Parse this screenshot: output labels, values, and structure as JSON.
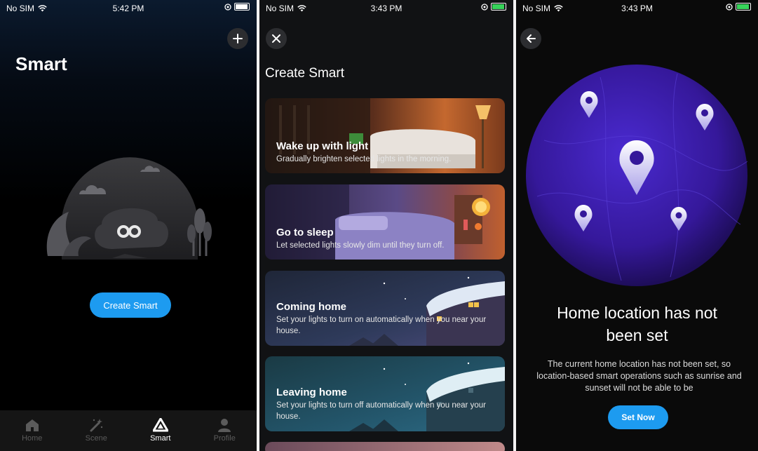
{
  "screens": [
    {
      "status": {
        "carrier": "No SIM",
        "time": "5:42 PM"
      },
      "title": "Smart",
      "add_icon": "plus-icon",
      "create_button": "Create Smart",
      "tabs": [
        {
          "label": "Home",
          "icon": "home-icon",
          "active": false
        },
        {
          "label": "Scene",
          "icon": "magic-wand-icon",
          "active": false
        },
        {
          "label": "Smart",
          "icon": "smart-triangle-icon",
          "active": true
        },
        {
          "label": "Profile",
          "icon": "profile-icon",
          "active": false
        }
      ]
    },
    {
      "status": {
        "carrier": "No SIM",
        "time": "3:43 PM"
      },
      "title": "Create Smart",
      "close_icon": "close-icon",
      "cards": [
        {
          "title": "Wake up with light",
          "description": "Gradually brighten selected lights in the morning."
        },
        {
          "title": "Go to sleep",
          "description": "Let selected lights slowly dim until they turn off."
        },
        {
          "title": "Coming home",
          "description": "Set your lights to turn on automatically when you near your house."
        },
        {
          "title": "Leaving home",
          "description": "Set your lights to turn off automatically when you near your house."
        }
      ]
    },
    {
      "status": {
        "carrier": "No SIM",
        "time": "3:43 PM"
      },
      "back_icon": "back-arrow-icon",
      "heading_line1": "Home location has not",
      "heading_line2": "been set",
      "body": "The current home location has not been set, so location-based smart operations such as sunrise and sunset will not be able to be",
      "button": "Set Now"
    }
  ],
  "colors": {
    "accent": "#1d9bf0",
    "globe": "#3b1fa8"
  }
}
